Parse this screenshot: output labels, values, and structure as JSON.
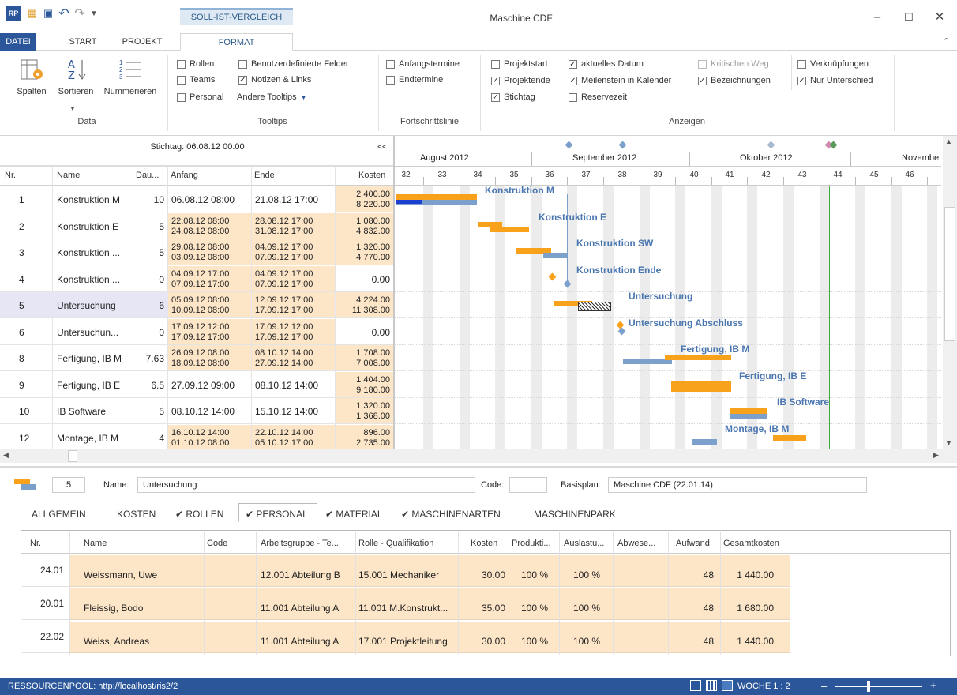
{
  "window": {
    "title": "Maschine CDF",
    "context_tab": "SOLL-IST-VERGLEICH"
  },
  "tabs": {
    "datei": "DATEI",
    "start": "START",
    "projekt": "PROJEKT",
    "format": "FORMAT"
  },
  "ribbon": {
    "data": {
      "spalten": "Spalten",
      "sortieren": "Sortieren",
      "nummerieren": "Nummerieren",
      "label": "Data"
    },
    "tooltips": {
      "rollen": "Rollen",
      "teams": "Teams",
      "personal": "Personal",
      "benutzer": "Benutzerdefinierte Felder",
      "notizen": "Notizen & Links",
      "andere": "Andere Tooltips",
      "label": "Tooltips"
    },
    "fortschritt": {
      "anfang": "Anfangstermine",
      "end": "Endtermine",
      "label": "Fortschrittslinie"
    },
    "anzeigen": {
      "projektstart": "Projektstart",
      "projektende": "Projektende",
      "stichtag": "Stichtag",
      "aktuelles": "aktuelles Datum",
      "meilenstein": "Meilenstein in Kalender",
      "reservezeit": "Reservezeit",
      "kritisch": "Kritischen Weg",
      "bezeichnungen": "Bezeichnungen",
      "verknuepfungen": "Verknüpfungen",
      "nurunterschied": "Nur Unterschied",
      "label": "Anzeigen"
    }
  },
  "grid": {
    "stichtag": "Stichtag: 06.08.12 00:00",
    "collapse": "<<",
    "headers": {
      "nr": "Nr.",
      "name": "Name",
      "dauer": "Dau...",
      "anfang": "Anfang",
      "ende": "Ende",
      "kosten": "Kosten"
    },
    "rows": [
      {
        "nr": "1",
        "name": "Konstruktion M",
        "dauer": "10",
        "anfang1": "06.08.12 08:00",
        "anfang2": "",
        "ende1": "21.08.12 17:00",
        "ende2": "",
        "kosten1": "2 400.00",
        "kosten2": "8 220.00"
      },
      {
        "nr": "2",
        "name": "Konstruktion E",
        "dauer": "5",
        "anfang1": "22.08.12 08:00",
        "anfang2": "24.08.12 08:00",
        "ende1": "28.08.12 17:00",
        "ende2": "31.08.12 17:00",
        "kosten1": "1 080.00",
        "kosten2": "4 832.00"
      },
      {
        "nr": "3",
        "name": "Konstruktion ...",
        "dauer": "5",
        "anfang1": "29.08.12 08:00",
        "anfang2": "03.09.12 08:00",
        "ende1": "04.09.12 17:00",
        "ende2": "07.09.12 17:00",
        "kosten1": "1 320.00",
        "kosten2": "4 770.00"
      },
      {
        "nr": "4",
        "name": "Konstruktion ...",
        "dauer": "0",
        "anfang1": "04.09.12 17:00",
        "anfang2": "07.09.12 17:00",
        "ende1": "04.09.12 17:00",
        "ende2": "07.09.12 17:00",
        "kosten1": "0.00",
        "kosten2": ""
      },
      {
        "nr": "5",
        "name": "Untersuchung",
        "dauer": "6",
        "anfang1": "05.09.12 08:00",
        "anfang2": "10.09.12 08:00",
        "ende1": "12.09.12 17:00",
        "ende2": "17.09.12 17:00",
        "kosten1": "4 224.00",
        "kosten2": "11 308.00"
      },
      {
        "nr": "6",
        "name": "Untersuchun...",
        "dauer": "0",
        "anfang1": "17.09.12 12:00",
        "anfang2": "17.09.12 17:00",
        "ende1": "17.09.12 12:00",
        "ende2": "17.09.12 17:00",
        "kosten1": "0.00",
        "kosten2": ""
      },
      {
        "nr": "8",
        "name": "Fertigung, IB M",
        "dauer": "7.63",
        "anfang1": "26.09.12 08:00",
        "anfang2": "18.09.12 08:00",
        "ende1": "08.10.12 14:00",
        "ende2": "27.09.12 14:00",
        "kosten1": "1 708.00",
        "kosten2": "7 008.00"
      },
      {
        "nr": "9",
        "name": "Fertigung, IB E",
        "dauer": "6.5",
        "anfang1": "27.09.12 09:00",
        "anfang2": "",
        "ende1": "08.10.12 14:00",
        "ende2": "",
        "kosten1": "1 404.00",
        "kosten2": "9 180.00"
      },
      {
        "nr": "10",
        "name": "IB Software",
        "dauer": "5",
        "anfang1": "08.10.12 14:00",
        "anfang2": "",
        "ende1": "15.10.12 14:00",
        "ende2": "",
        "kosten1": "1 320.00",
        "kosten2": "1 368.00"
      },
      {
        "nr": "12",
        "name": "Montage, IB M",
        "dauer": "4",
        "anfang1": "16.10.12 14:00",
        "anfang2": "01.10.12 08:00",
        "ende1": "22.10.12 14:00",
        "ende2": "05.10.12 17:00",
        "kosten1": "896.00",
        "kosten2": "2 735.00"
      }
    ]
  },
  "gantt": {
    "months": [
      "August 2012",
      "September 2012",
      "Oktober 2012",
      "Novembe"
    ],
    "weeks": [
      "32",
      "33",
      "34",
      "35",
      "36",
      "37",
      "38",
      "39",
      "40",
      "41",
      "42",
      "43",
      "44",
      "45",
      "46"
    ],
    "labels": [
      "Konstruktion M",
      "Konstruktion E",
      "Konstruktion SW",
      "Konstruktion Ende",
      "Untersuchung",
      "Untersuchung Abschluss",
      "Fertigung, IB M",
      "Fertigung, IB E",
      "IB Software",
      "Montage, IB M"
    ],
    "colors": {
      "soll": "#f7a21a",
      "ist": "#7ba0cc",
      "today": "#3aaa3a"
    }
  },
  "detail": {
    "number": "5",
    "name_label": "Name:",
    "name_value": "Untersuchung",
    "code_label": "Code:",
    "code_value": "",
    "basisplan_label": "Basisplan:",
    "basisplan_value": "Maschine CDF (22.01.14)",
    "tabs": [
      "ALLGEMEIN",
      "KOSTEN",
      "✔ ROLLEN",
      "✔ PERSONAL",
      "✔ MATERIAL",
      "✔ MASCHINENARTEN",
      "MASCHINENPARK"
    ],
    "headers": [
      "Nr.",
      "Name",
      "Code",
      "Arbeitsgruppe - Te...",
      "Rolle - Qualifikation",
      "Kosten",
      "Produkti...",
      "Auslastu...",
      "Abwese...",
      "Aufwand",
      "Gesamtkosten"
    ],
    "rows": [
      {
        "nr": "24.01",
        "name": "Weissmann, Uwe",
        "gruppe": "12.001 Abteilung B",
        "rolle": "15.001 Mechaniker",
        "kosten": "30.00",
        "prod": "100 %",
        "ausl": "100 %",
        "aufwand": "48",
        "gesamt": "1 440.00"
      },
      {
        "nr": "20.01",
        "name": "Fleissig, Bodo",
        "gruppe": "11.001 Abteilung A",
        "rolle": "11.001 M.Konstrukt...",
        "kosten": "35.00",
        "prod": "100 %",
        "ausl": "100 %",
        "aufwand": "48",
        "gesamt": "1 680.00"
      },
      {
        "nr": "22.02",
        "name": "Weiss, Andreas",
        "gruppe": "11.001 Abteilung A",
        "rolle": "17.001 Projektleitung",
        "kosten": "30.00",
        "prod": "100 %",
        "ausl": "100 %",
        "aufwand": "48",
        "gesamt": "1 440.00"
      }
    ]
  },
  "status": {
    "text": "RESSOURCENPOOL: http://localhost/ris2/2",
    "zoom": "WOCHE 1 : 2"
  }
}
